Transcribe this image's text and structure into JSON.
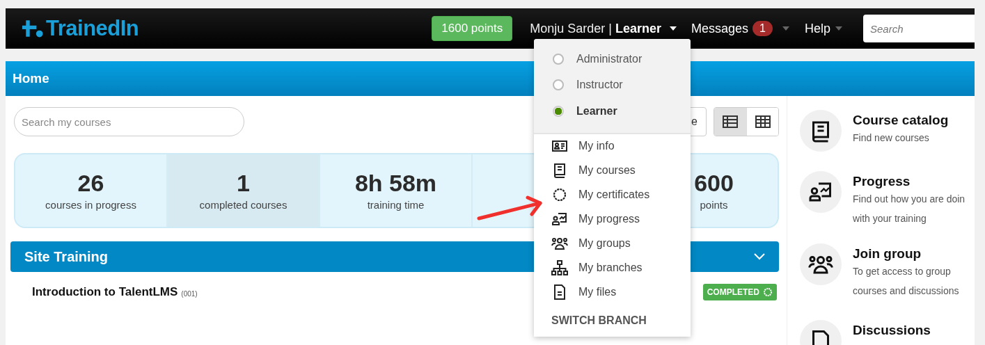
{
  "topbar": {
    "logo": "TrainedIn",
    "points": "1600 points",
    "user": "Monju Sarder | **Learner**",
    "messages": "Messages",
    "messages_count": "1",
    "help": "Help",
    "search": {
      "placeholder": "Search"
    }
  },
  "page_title": "Home",
  "course_search": {
    "placeholder": "Search my courses"
  },
  "catalog_button": {
    "label": "e"
  },
  "view_toggle": [
    {
      "selected": true
    },
    {
      "selected": false
    }
  ],
  "stats": [
    {
      "value": "26",
      "label": "courses in progress",
      "highlighted": false
    },
    {
      "value": "1",
      "label": "completed courses",
      "highlighted": true
    },
    {
      "value": "8h 58m",
      "label": "training time",
      "highlighted": false
    },
    {
      "value": "600",
      "label": "points",
      "highlighted": false
    }
  ],
  "category": {
    "title": "Site Training",
    "expanded": true
  },
  "courses": [
    {
      "title": "Introduction to TalentLMS",
      "code": "(001)",
      "status": "COMPLETED"
    }
  ],
  "user_menu": {
    "roles": [
      {
        "label": "Administrator",
        "selected": false
      },
      {
        "label": "Instructor",
        "selected": false
      },
      {
        "label": "Learner",
        "selected": true
      }
    ],
    "items": [
      "My info",
      "My courses",
      "My certificates",
      "My progress",
      "My groups",
      "My branches",
      "My files"
    ],
    "section": "SWITCH BRANCH"
  },
  "shortcuts": [
    {
      "title": "Course catalog",
      "description": "Find new courses"
    },
    {
      "title": "Progress",
      "description": "Find out how you are doin\nwith your training"
    },
    {
      "title": "Join group",
      "description": "To get access to group\ncourses and discussions"
    },
    {
      "title": "Discussions"
    }
  ]
}
